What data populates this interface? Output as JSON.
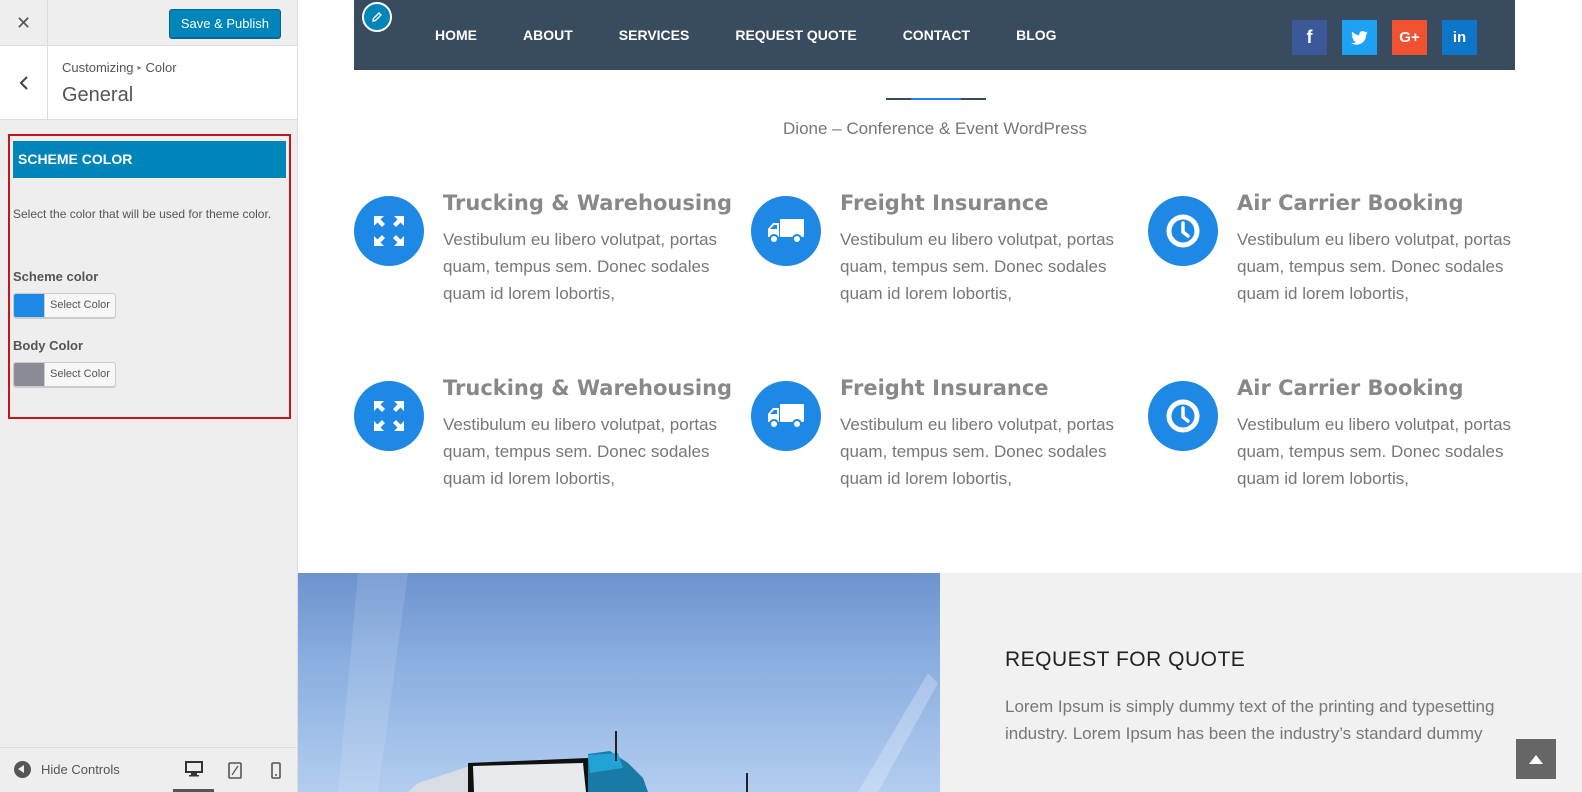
{
  "customizer": {
    "close_icon": "close-icon",
    "save_label": "Save & Publish",
    "breadcrumb": {
      "parent": "Customizing",
      "child": "Color"
    },
    "section_title": "General",
    "scheme_heading": "SCHEME COLOR",
    "scheme_description": "Select the color that will be used for theme color.",
    "controls": [
      {
        "label": "Scheme color",
        "button_label": "Select Color",
        "swatch": "#1e88e5"
      },
      {
        "label": "Body Color",
        "button_label": "Select Color",
        "swatch": "#8a8d96"
      }
    ],
    "footer": {
      "hide_label": "Hide Controls",
      "devices": [
        "desktop-icon",
        "tablet-icon",
        "mobile-icon"
      ]
    },
    "accent": "#0085ba"
  },
  "preview": {
    "nav": [
      "HOME",
      "ABOUT",
      "SERVICES",
      "REQUEST QUOTE",
      "CONTACT",
      "BLOG"
    ],
    "social": [
      {
        "name": "facebook-icon",
        "glyph": "f",
        "color": "#3b5998"
      },
      {
        "name": "twitter-icon",
        "glyph": "t",
        "color": "#1da1f2"
      },
      {
        "name": "google-plus-icon",
        "glyph": "G+",
        "color": "#f0522f"
      },
      {
        "name": "linkedin-icon",
        "glyph": "in",
        "color": "#0e76c9"
      }
    ],
    "subtitle": "Dione – Conference & Event WordPress",
    "features": [
      {
        "title": "Trucking & Warehousing",
        "text": "Vestibulum eu libero volutpat, portas quam, tempus sem. Donec sodales quam id lorem lobortis,",
        "icon": "expand-icon"
      },
      {
        "title": "Freight Insurance",
        "text": "Vestibulum eu libero volutpat, portas quam, tempus sem. Donec sodales quam id lorem lobortis,",
        "icon": "truck-icon"
      },
      {
        "title": "Air Carrier Booking",
        "text": "Vestibulum eu libero volutpat, portas quam, tempus sem. Donec sodales quam id lorem lobortis,",
        "icon": "clock-icon"
      },
      {
        "title": "Trucking & Warehousing",
        "text": "Vestibulum eu libero volutpat, portas quam, tempus sem. Donec sodales quam id lorem lobortis,",
        "icon": "expand-icon"
      },
      {
        "title": "Freight Insurance",
        "text": "Vestibulum eu libero volutpat, portas quam, tempus sem. Donec sodales quam id lorem lobortis,",
        "icon": "truck-icon"
      },
      {
        "title": "Air Carrier Booking",
        "text": "Vestibulum eu libero volutpat, portas quam, tempus sem. Donec sodales quam id lorem lobortis,",
        "icon": "clock-icon"
      }
    ],
    "quote": {
      "title": "REQUEST FOR QUOTE",
      "text": "Lorem Ipsum is simply dummy text of the printing and typesetting industry. Lorem Ipsum has been the industry’s standard dummy"
    },
    "theme_color": "#1e88e5",
    "nav_bg": "#394b5f"
  }
}
